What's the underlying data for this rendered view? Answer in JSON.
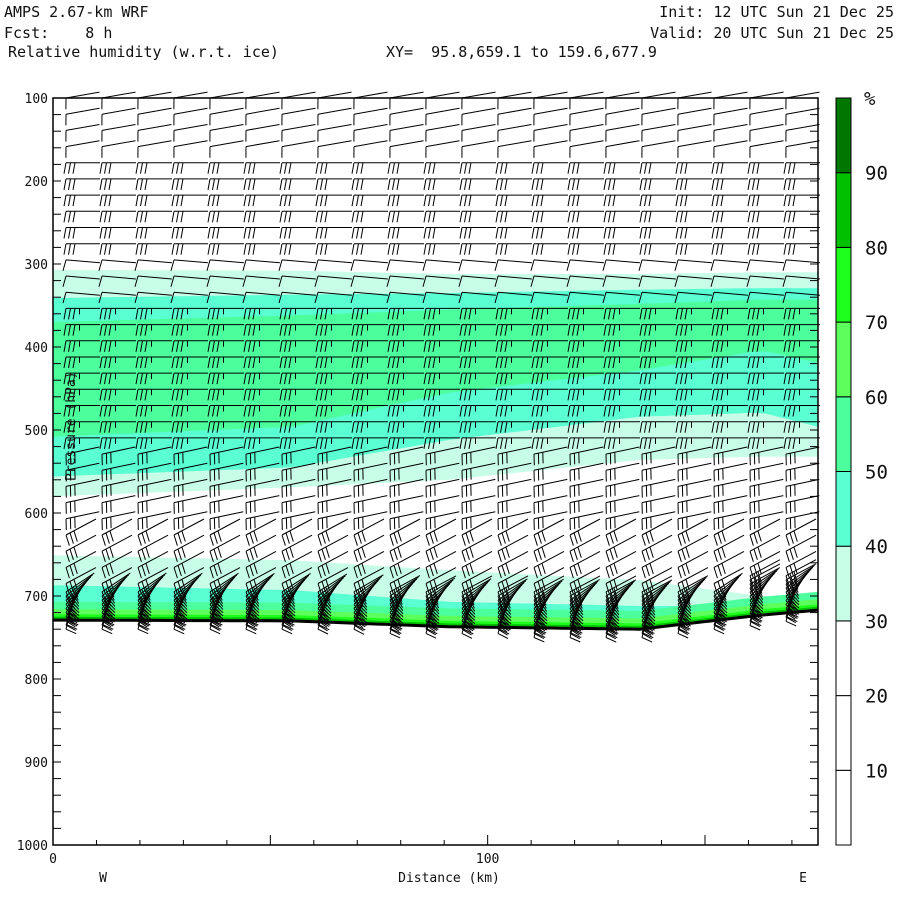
{
  "header": {
    "model": "AMPS 2.67-km WRF",
    "fcst": "Fcst:    8 h",
    "field": "Relative humidity (w.r.t. ice)",
    "xy": "XY=  95.8,659.1 to 159.6,677.9",
    "init": "Init: 12 UTC Sun 21 Dec 25",
    "valid": "Valid: 20 UTC Sun 21 Dec 25"
  },
  "chart_data": {
    "type": "heatmap",
    "title": "Relative humidity (w.r.t. ice)",
    "xlabel": "Distance (km)",
    "ylabel": "Pressure (hPa)",
    "xlim": [
      0,
      176
    ],
    "ylim": [
      1000,
      100
    ],
    "x_ticks": [
      "0",
      "100"
    ],
    "y_ticks": [
      "100",
      "200",
      "300",
      "400",
      "500",
      "600",
      "700",
      "800",
      "900",
      "1000"
    ],
    "left_end_label": "W",
    "right_end_label": "E",
    "colorbar": {
      "unit": "%",
      "labels": [
        "10",
        "20",
        "30",
        "40",
        "50",
        "60",
        "70",
        "80",
        "90"
      ],
      "levels": [
        0,
        10,
        20,
        30,
        40,
        50,
        60,
        70,
        80,
        90,
        100
      ],
      "colors": [
        "#ffffff",
        "#ffffff",
        "#ffffff",
        "#c8fde8",
        "#5affd2",
        "#4cff9c",
        "#5cff5c",
        "#1eff1e",
        "#00c000",
        "#007800"
      ]
    },
    "x_km": [
      0,
      55,
      91,
      135,
      163,
      176
    ],
    "terrain_hPa": [
      729,
      730,
      737,
      740,
      723,
      717
    ],
    "rh_regions": [
      {
        "min_rh": 30,
        "top_hPa": [
          307,
          308,
          312,
          312,
          310,
          310
        ],
        "bottom_hPa": [
          580,
          569,
          560,
          536,
          532,
          532
        ]
      },
      {
        "min_rh": 40,
        "top_hPa": [
          341,
          337,
          335,
          331,
          329,
          329
        ],
        "bottom_hPa": [
          556,
          545,
          512,
          484,
          479,
          496
        ]
      },
      {
        "min_rh": 50,
        "top_hPa": [
          370,
          362,
          355,
          348,
          343,
          343
        ],
        "bottom_hPa": [
          508,
          496,
          455,
          428,
          404,
          419
        ]
      },
      {
        "min_rh": 30,
        "top_hPa": [
          651,
          657,
          669,
          681,
          700,
          708
        ],
        "bottom_hPa": "terrain"
      },
      {
        "min_rh": 40,
        "top_hPa": [
          687,
          693,
          707,
          712,
          712,
          713
        ],
        "bottom_hPa": "terrain"
      },
      {
        "min_rh": 50,
        "above_terrain_hPa": 22
      },
      {
        "min_rh": 60,
        "above_terrain_hPa": 13
      },
      {
        "min_rh": 70,
        "above_terrain_hPa": 7
      },
      {
        "min_rh": 80,
        "above_terrain_hPa": 4
      }
    ],
    "wind_profile": [
      {
        "p_min": 100,
        "p_max": 170,
        "dir_deg": 80,
        "speed_kt": 10
      },
      {
        "p_min": 171,
        "p_max": 290,
        "dir_deg": 90,
        "speed_kt": 30
      },
      {
        "p_min": 291,
        "p_max": 335,
        "dir_deg": 95,
        "speed_kt": 10
      },
      {
        "p_min": 336,
        "p_max": 520,
        "dir_deg": 90,
        "speed_kt": 35
      },
      {
        "p_min": 521,
        "p_max": 610,
        "dir_deg": 78,
        "speed_kt": 30
      },
      {
        "p_min": 611,
        "p_max": 760,
        "dir_deg": 62,
        "speed_kt": 30
      }
    ]
  }
}
